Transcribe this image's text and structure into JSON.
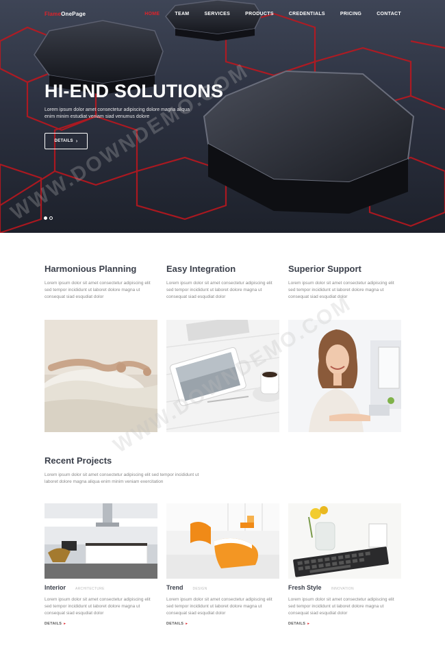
{
  "nav": {
    "logo_part1": "Flame",
    "logo_part2": "OnePage",
    "items": [
      {
        "label": "HOME",
        "active": true
      },
      {
        "label": "TEAM",
        "active": false
      },
      {
        "label": "SERVICES",
        "active": false
      },
      {
        "label": "PRODUCTS",
        "active": false
      },
      {
        "label": "CREDENTIALS",
        "active": false
      },
      {
        "label": "PRICING",
        "active": false
      },
      {
        "label": "CONTACT",
        "active": false
      }
    ]
  },
  "hero": {
    "title": "HI-END SOLUTIONS",
    "text": "Lorem ipsum dolor amet consectetur adipiscing dolore magna aliqua enim minim estudiat veniam siad venumus dolore",
    "button": "DETAILS",
    "button_icon": "chevron-right-icon",
    "slides": 2,
    "active_slide": 1
  },
  "features": [
    {
      "title": "Harmonious Planning",
      "text": "Lorem ipsum dolor sit amet consectetur adipiscing elit sed tempor incididunt ut laboret dolore magna ut consequat siad esqudiat dolor"
    },
    {
      "title": "Easy Integration",
      "text": "Lorem ipsum dolor sit amet consectetur adipiscing elit sed tempor incididunt ut laboret dolore magna ut consequat siad esqudiat dolor"
    },
    {
      "title": "Superior Support",
      "text": "Lorem ipsum dolor sit amet consectetur adipiscing elit sed tempor incididunt ut laboret dolore magna ut consequat siad esqudiat dolor"
    }
  ],
  "recent": {
    "title": "Recent Projects",
    "text": "Lorem ipsum dolor sit amet consectetur adipiscing elit sed tempor incididunt ut laboret dolore magna aliqua enim minim veniam exercitation"
  },
  "projects": [
    {
      "name": "Interior",
      "category": "ARCHITECTURE",
      "text": "Lorem ipsum dolor sit amet consectetur adipiscing elit sed tempor incididunt ut laboret dolore magna ut consequat siad esqudiat dolor",
      "more": "DETAILS",
      "more_icon": "arrow-right-icon"
    },
    {
      "name": "Trend",
      "category": "DESIGN",
      "text": "Lorem ipsum dolor sit amet consectetur adipiscing elit sed tempor incididunt ut laboret dolore magna ut consequat siad esqudiat dolor",
      "more": "DETAILS",
      "more_icon": "arrow-right-icon"
    },
    {
      "name": "Fresh Style",
      "category": "INNOVATION",
      "text": "Lorem ipsum dolor sit amet consectetur adipiscing elit sed tempor incididunt ut laboret dolore magna ut consequat siad esqudiat dolor",
      "more": "DETAILS",
      "more_icon": "arrow-right-icon"
    }
  ],
  "watermark": "WWW.DOWNDEMO.COM",
  "colors": {
    "accent": "#e0232a",
    "hero_dark": "#2c3140",
    "heading": "#3a3f4a",
    "body_text": "#888888"
  }
}
